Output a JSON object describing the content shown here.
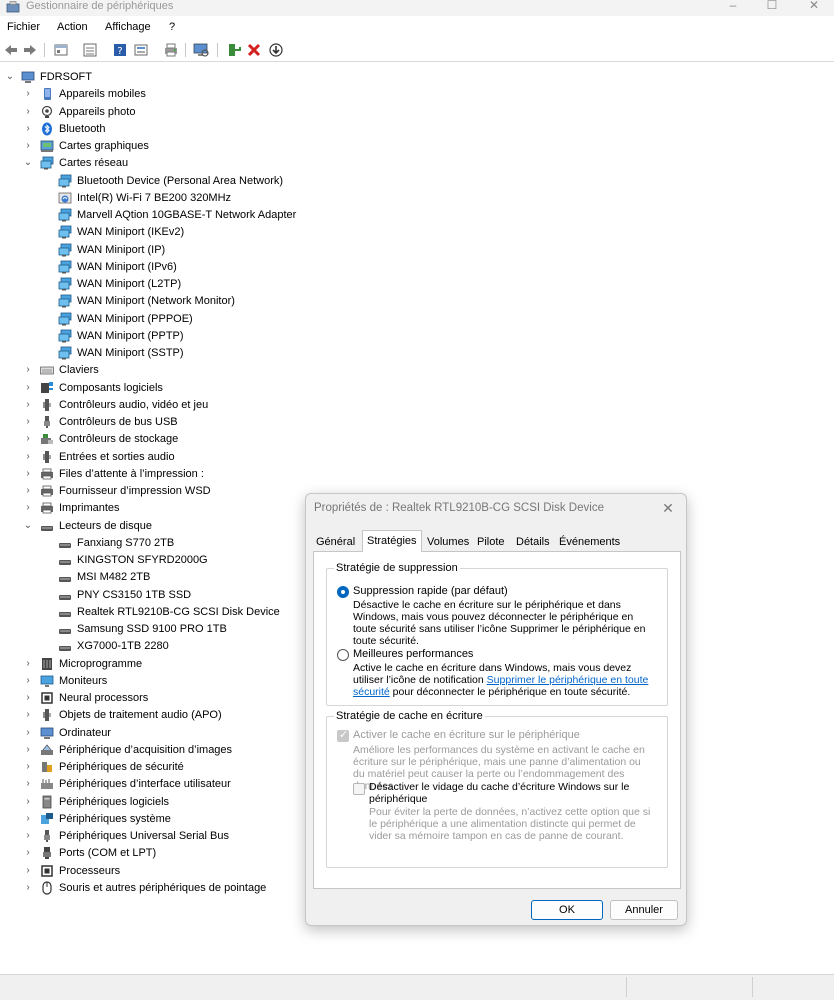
{
  "window": {
    "title": "Gestionnaire de périphériques"
  },
  "menu": [
    "Fichier",
    "Action",
    "Affichage",
    "?"
  ],
  "tree": {
    "root": "FDRSOFT",
    "items": [
      {
        "label": "Appareils mobiles",
        "icon": "mobile-device-icon",
        "depth": 1,
        "state": "collapsed"
      },
      {
        "label": "Appareils photo",
        "icon": "camera-icon",
        "depth": 1,
        "state": "collapsed"
      },
      {
        "label": "Bluetooth",
        "icon": "bluetooth-icon",
        "depth": 1,
        "state": "collapsed"
      },
      {
        "label": "Cartes graphiques",
        "icon": "display-adapter-icon",
        "depth": 1,
        "state": "collapsed"
      },
      {
        "label": "Cartes réseau",
        "icon": "network-adapter-icon",
        "depth": 1,
        "state": "expanded"
      },
      {
        "label": "Bluetooth Device (Personal Area Network)",
        "icon": "network-adapter-icon",
        "depth": 2
      },
      {
        "label": "Intel(R) Wi-Fi 7 BE200 320MHz",
        "icon": "wifi-adapter-icon",
        "depth": 2
      },
      {
        "label": "Marvell AQtion 10GBASE-T Network Adapter",
        "icon": "network-adapter-icon",
        "depth": 2
      },
      {
        "label": "WAN Miniport (IKEv2)",
        "icon": "network-adapter-icon",
        "depth": 2
      },
      {
        "label": "WAN Miniport (IP)",
        "icon": "network-adapter-icon",
        "depth": 2
      },
      {
        "label": "WAN Miniport (IPv6)",
        "icon": "network-adapter-icon",
        "depth": 2
      },
      {
        "label": "WAN Miniport (L2TP)",
        "icon": "network-adapter-icon",
        "depth": 2
      },
      {
        "label": "WAN Miniport (Network Monitor)",
        "icon": "network-adapter-icon",
        "depth": 2
      },
      {
        "label": "WAN Miniport (PPPOE)",
        "icon": "network-adapter-icon",
        "depth": 2
      },
      {
        "label": "WAN Miniport (PPTP)",
        "icon": "network-adapter-icon",
        "depth": 2
      },
      {
        "label": "WAN Miniport (SSTP)",
        "icon": "network-adapter-icon",
        "depth": 2
      },
      {
        "label": "Claviers",
        "icon": "keyboard-icon",
        "depth": 1,
        "state": "collapsed"
      },
      {
        "label": "Composants logiciels",
        "icon": "software-component-icon",
        "depth": 1,
        "state": "collapsed"
      },
      {
        "label": "Contrôleurs audio, vidéo et jeu",
        "icon": "speaker-icon",
        "depth": 1,
        "state": "collapsed"
      },
      {
        "label": "Contrôleurs de bus USB",
        "icon": "usb-icon",
        "depth": 1,
        "state": "collapsed"
      },
      {
        "label": "Contrôleurs de stockage",
        "icon": "storage-controller-icon",
        "depth": 1,
        "state": "collapsed"
      },
      {
        "label": "Entrées et sorties audio",
        "icon": "speaker-icon",
        "depth": 1,
        "state": "collapsed"
      },
      {
        "label": "Files d’attente à l’impression :",
        "icon": "printer-icon",
        "depth": 1,
        "state": "collapsed"
      },
      {
        "label": "Fournisseur d’impression WSD",
        "icon": "printer-icon",
        "depth": 1,
        "state": "collapsed"
      },
      {
        "label": "Imprimantes",
        "icon": "printer-icon",
        "depth": 1,
        "state": "collapsed"
      },
      {
        "label": "Lecteurs de disque",
        "icon": "disk-drive-icon",
        "depth": 1,
        "state": "expanded"
      },
      {
        "label": "Fanxiang S770 2TB",
        "icon": "disk-drive-icon",
        "depth": 2
      },
      {
        "label": "KINGSTON SFYRD2000G",
        "icon": "disk-drive-icon",
        "depth": 2
      },
      {
        "label": "MSI M482 2TB",
        "icon": "disk-drive-icon",
        "depth": 2
      },
      {
        "label": "PNY CS3150 1TB SSD",
        "icon": "disk-drive-icon",
        "depth": 2
      },
      {
        "label": "Realtek RTL9210B-CG SCSI Disk Device",
        "icon": "disk-drive-icon",
        "depth": 2
      },
      {
        "label": "Samsung SSD 9100 PRO 1TB",
        "icon": "disk-drive-icon",
        "depth": 2
      },
      {
        "label": "XG7000-1TB 2280",
        "icon": "disk-drive-icon",
        "depth": 2
      },
      {
        "label": "Microprogramme",
        "icon": "firmware-icon",
        "depth": 1,
        "state": "collapsed"
      },
      {
        "label": "Moniteurs",
        "icon": "monitor-icon",
        "depth": 1,
        "state": "collapsed"
      },
      {
        "label": "Neural processors",
        "icon": "processor-icon",
        "depth": 1,
        "state": "collapsed"
      },
      {
        "label": "Objets de traitement audio (APO)",
        "icon": "speaker-icon",
        "depth": 1,
        "state": "collapsed"
      },
      {
        "label": "Ordinateur",
        "icon": "computer-icon",
        "depth": 1,
        "state": "collapsed"
      },
      {
        "label": "Périphérique d’acquisition d’images",
        "icon": "scanner-icon",
        "depth": 1,
        "state": "collapsed"
      },
      {
        "label": "Périphériques de sécurité",
        "icon": "security-device-icon",
        "depth": 1,
        "state": "collapsed"
      },
      {
        "label": "Périphériques d’interface utilisateur",
        "icon": "hid-icon",
        "depth": 1,
        "state": "collapsed"
      },
      {
        "label": "Périphériques logiciels",
        "icon": "software-device-icon",
        "depth": 1,
        "state": "collapsed"
      },
      {
        "label": "Périphériques système",
        "icon": "system-device-icon",
        "depth": 1,
        "state": "collapsed"
      },
      {
        "label": "Périphériques Universal Serial Bus",
        "icon": "usb-icon",
        "depth": 1,
        "state": "collapsed"
      },
      {
        "label": "Ports (COM et LPT)",
        "icon": "port-icon",
        "depth": 1,
        "state": "collapsed"
      },
      {
        "label": "Processeurs",
        "icon": "processor-icon",
        "depth": 1,
        "state": "collapsed"
      },
      {
        "label": "Souris et autres périphériques de pointage",
        "icon": "mouse-icon",
        "depth": 1,
        "state": "collapsed"
      }
    ]
  },
  "dialog": {
    "title": "Propriétés de : Realtek RTL9210B-CG SCSI Disk Device",
    "tabs": [
      {
        "label": "Général",
        "active": false
      },
      {
        "label": "Stratégies",
        "active": true
      },
      {
        "label": "Volumes",
        "active": false
      },
      {
        "label": "Pilote",
        "active": false
      },
      {
        "label": "Détails",
        "active": false
      },
      {
        "label": "Événements",
        "active": false
      }
    ],
    "removal_group": {
      "legend": "Stratégie de suppression",
      "quick_label": "Suppression rapide (par défaut)",
      "quick_selected": true,
      "quick_desc": "Désactive le cache en écriture sur le périphérique et dans Windows, mais vous pouvez déconnecter le périphérique en toute sécurité sans utiliser l’icône Supprimer le périphérique en toute sécurité.",
      "perf_label": "Meilleures performances",
      "perf_selected": false,
      "perf_desc_1": "Active le cache en écriture dans Windows, mais vous devez utiliser l’icône de notification",
      "perf_link": "Supprimer le périphérique en toute sécurité",
      "perf_desc_2": " pour déconnecter le périphérique en toute sécurité."
    },
    "cache_group": {
      "legend": "Stratégie de cache en écriture",
      "enable_label": "Activer le cache en écriture sur le périphérique",
      "enable_checked": true,
      "enable_desc": "Améliore les performances du système en activant le cache en écriture sur le périphérique, mais une panne d’alimentation ou du matériel peut causer la perte ou l’endommagement des données.",
      "flush_label": "Désactiver le vidage du cache d’écriture Windows sur le périphérique",
      "flush_checked": false,
      "flush_desc": "Pour éviter la perte de données, n’activez cette option que si le périphérique a une alimentation distincte qui permet de vider sa mémoire tampon en cas de panne de courant."
    },
    "ok_label": "OK",
    "cancel_label": "Annuler"
  },
  "colors": {
    "accent": "#0067c0",
    "link": "#0066cc",
    "dialog_bg": "#f0f0f0"
  }
}
